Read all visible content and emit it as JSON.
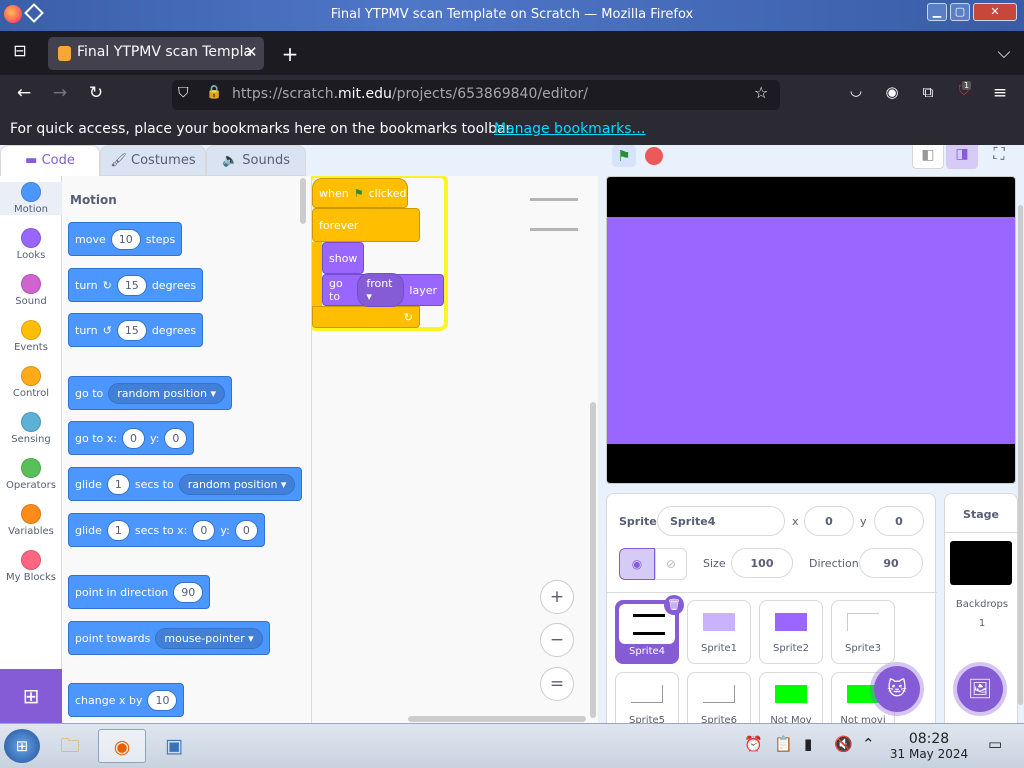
{
  "window": {
    "title": "Final YTPMV scan Template on Scratch — Mozilla Firefox"
  },
  "browser": {
    "tab_title": "Final YTPMV scan Templa",
    "url_prefix": "https://scratch.",
    "url_domain": "mit.edu",
    "url_path": "/projects/653869840/editor/",
    "bookmarks_text": "For quick access, place your bookmarks here on the bookmarks toolbar.",
    "bookmarks_link": "Manage bookmarks…",
    "badge": "1"
  },
  "editor": {
    "tabs": [
      "Code",
      "Costumes",
      "Sounds"
    ],
    "categories": [
      {
        "label": "Motion",
        "color": "#4c97ff"
      },
      {
        "label": "Looks",
        "color": "#9966ff"
      },
      {
        "label": "Sound",
        "color": "#cf63cf"
      },
      {
        "label": "Events",
        "color": "#ffbf00"
      },
      {
        "label": "Control",
        "color": "#ffab19"
      },
      {
        "label": "Sensing",
        "color": "#5cb1d6"
      },
      {
        "label": "Operators",
        "color": "#59c059"
      },
      {
        "label": "Variables",
        "color": "#ff8c1a"
      },
      {
        "label": "My Blocks",
        "color": "#ff6680"
      }
    ],
    "palette_heading": "Motion",
    "blocks": {
      "move": {
        "a": "move",
        "v": "10",
        "b": "steps"
      },
      "turn_r": {
        "a": "turn",
        "v": "15",
        "b": "degrees"
      },
      "turn_l": {
        "a": "turn",
        "v": "15",
        "b": "degrees"
      },
      "goto": {
        "a": "go to",
        "d": "random position"
      },
      "gotoxy": {
        "a": "go to x:",
        "x": "0",
        "y_label": "y:",
        "y": "0"
      },
      "glide1": {
        "a": "glide",
        "v": "1",
        "b": "secs to",
        "d": "random position"
      },
      "glide2": {
        "a": "glide",
        "v": "1",
        "b": "secs to x:",
        "x": "0",
        "y_label": "y:",
        "y": "0"
      },
      "point": {
        "a": "point in direction",
        "v": "90"
      },
      "towards": {
        "a": "point towards",
        "d": "mouse-pointer"
      },
      "changex": {
        "a": "change x by",
        "v": "10"
      }
    },
    "script": {
      "when": "when",
      "clicked": "clicked",
      "forever": "forever",
      "show": "show",
      "goto_a": "go to",
      "goto_d": "front",
      "goto_b": "layer"
    },
    "zoom": {
      "in": "+",
      "out": "−",
      "reset": "="
    }
  },
  "sprite_info": {
    "sprite_label": "Sprite",
    "sprite_name": "Sprite4",
    "x_label": "x",
    "x": "0",
    "y_label": "y",
    "y": "0",
    "size_label": "Size",
    "size": "100",
    "direction_label": "Direction",
    "direction": "90"
  },
  "sprites": [
    {
      "name": "Sprite4",
      "selected": true,
      "color": "#000000"
    },
    {
      "name": "Sprite1",
      "selected": false,
      "color": "#c9b3ff"
    },
    {
      "name": "Sprite2",
      "selected": false,
      "color": "#9966ff"
    },
    {
      "name": "Sprite3",
      "selected": false,
      "color": "#ffffff"
    },
    {
      "name": "Sprite5",
      "selected": false,
      "color": "#ffffff"
    },
    {
      "name": "Sprite6",
      "selected": false,
      "color": "#ffffff"
    },
    {
      "name": "Not Mov",
      "selected": false,
      "color": "#00ff00"
    },
    {
      "name": "Not movi",
      "selected": false,
      "color": "#00ff00"
    }
  ],
  "stage_panel": {
    "title": "Stage",
    "backdrops_label": "Backdrops",
    "backdrops_count": "1"
  },
  "taskbar": {
    "time": "08:28",
    "date": "31 May 2024"
  }
}
